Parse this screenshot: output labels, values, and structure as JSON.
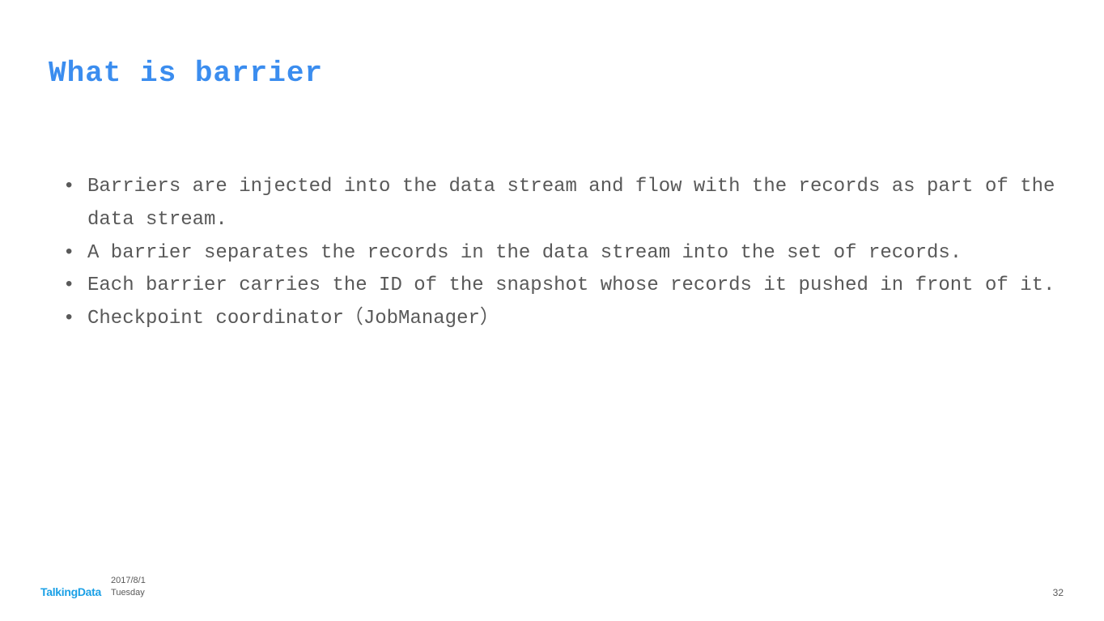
{
  "title": "What is barrier",
  "bullets": [
    "Barriers are injected into the data stream and flow with the records as part of the data stream.",
    "A barrier separates the records in the data stream into the set of records.",
    "Each barrier carries the ID of the snapshot whose records it pushed in front of it.",
    "Checkpoint coordinator（JobManager）"
  ],
  "footer": {
    "logo": "TalkingData",
    "date": "2017/8/1",
    "day": "Tuesday",
    "page": "32"
  }
}
